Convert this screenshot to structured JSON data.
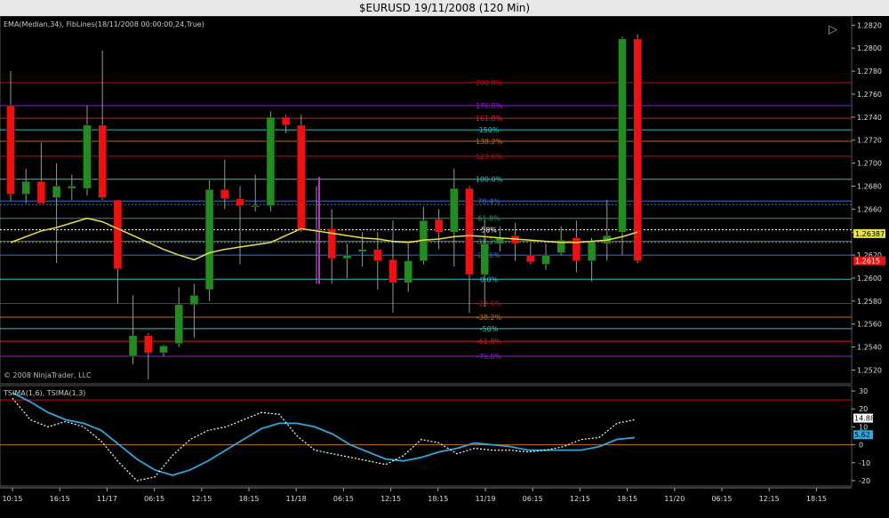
{
  "title": "$EURUSD  19/11/2008 (120 Min)",
  "indicator_label_main": "EMA(Median,34), FibLines(18/11/2008 00:00:00,24,True)",
  "indicator_label_sub": "TSIMA(1,6), TSIMA(1,3)",
  "copyright": "© 2008 NinjaTrader, LLC",
  "colors": {
    "up": "#228b22",
    "down": "#e11",
    "ema": "#e6e04a",
    "tsima6": "#2ea7e0",
    "tsima3": "#ffffff"
  },
  "chart_data": [
    {
      "type": "candlestick",
      "ylim": [
        1.2508,
        1.2828
      ],
      "price_ticks": [
        "1.2520",
        "1.2540",
        "1.2560",
        "1.2580",
        "1.2600",
        "1.2620",
        "1.2640",
        "1.2660",
        "1.2680",
        "1.2700",
        "1.2720",
        "1.2740",
        "1.2760",
        "1.2780",
        "1.2800",
        "1.2820"
      ],
      "x_ticks": [
        "10:15",
        "16:15",
        "11/17",
        "06:15",
        "12:15",
        "18:15",
        "11/18",
        "06:15",
        "12:15",
        "18:15",
        "11/19",
        "06:15",
        "12:15",
        "18:15",
        "11/20",
        "06:15",
        "12:15",
        "18:15"
      ],
      "candles": [
        {
          "o": 1.275,
          "h": 1.278,
          "l": 1.2667,
          "c": 1.2673
        },
        {
          "o": 1.2673,
          "h": 1.2695,
          "l": 1.2665,
          "c": 1.2684
        },
        {
          "o": 1.2684,
          "h": 1.2718,
          "l": 1.2665,
          "c": 1.2665
        },
        {
          "o": 1.267,
          "h": 1.27,
          "l": 1.2613,
          "c": 1.268
        },
        {
          "o": 1.2678,
          "h": 1.269,
          "l": 1.2668,
          "c": 1.268
        },
        {
          "o": 1.2678,
          "h": 1.275,
          "l": 1.2672,
          "c": 1.2733
        },
        {
          "o": 1.2733,
          "h": 1.2798,
          "l": 1.2668,
          "c": 1.267
        },
        {
          "o": 1.2668,
          "h": 1.2668,
          "l": 1.2578,
          "c": 1.2608
        },
        {
          "o": 1.2532,
          "h": 1.2585,
          "l": 1.2525,
          "c": 1.255
        },
        {
          "o": 1.255,
          "h": 1.2552,
          "l": 1.2512,
          "c": 1.2535
        },
        {
          "o": 1.2535,
          "h": 1.2542,
          "l": 1.2532,
          "c": 1.2541
        },
        {
          "o": 1.2543,
          "h": 1.2592,
          "l": 1.254,
          "c": 1.2577
        },
        {
          "o": 1.2577,
          "h": 1.2595,
          "l": 1.2548,
          "c": 1.2585
        },
        {
          "o": 1.259,
          "h": 1.2685,
          "l": 1.258,
          "c": 1.2677
        },
        {
          "o": 1.2677,
          "h": 1.2703,
          "l": 1.266,
          "c": 1.2669
        },
        {
          "o": 1.2669,
          "h": 1.268,
          "l": 1.2612,
          "c": 1.2663
        },
        {
          "o": 1.2663,
          "h": 1.269,
          "l": 1.2658,
          "c": 1.2663
        },
        {
          "o": 1.2663,
          "h": 1.2745,
          "l": 1.2658,
          "c": 1.274
        },
        {
          "o": 1.274,
          "h": 1.2742,
          "l": 1.2726,
          "c": 1.2733
        },
        {
          "o": 1.2733,
          "h": 1.2742,
          "l": 1.264,
          "c": 1.2642
        },
        {
          "o": 1.2642,
          "h": 1.268,
          "l": 1.2595,
          "c": 1.2642
        },
        {
          "o": 1.2643,
          "h": 1.266,
          "l": 1.2595,
          "c": 1.2617
        },
        {
          "o": 1.2617,
          "h": 1.263,
          "l": 1.26,
          "c": 1.262
        },
        {
          "o": 1.2623,
          "h": 1.264,
          "l": 1.261,
          "c": 1.2625
        },
        {
          "o": 1.2625,
          "h": 1.264,
          "l": 1.259,
          "c": 1.2615
        },
        {
          "o": 1.2616,
          "h": 1.265,
          "l": 1.257,
          "c": 1.2596
        },
        {
          "o": 1.2596,
          "h": 1.263,
          "l": 1.2588,
          "c": 1.2615
        },
        {
          "o": 1.2615,
          "h": 1.2662,
          "l": 1.2612,
          "c": 1.265
        },
        {
          "o": 1.2651,
          "h": 1.266,
          "l": 1.2625,
          "c": 1.264
        },
        {
          "o": 1.264,
          "h": 1.2695,
          "l": 1.261,
          "c": 1.2678
        },
        {
          "o": 1.2678,
          "h": 1.268,
          "l": 1.257,
          "c": 1.2603
        },
        {
          "o": 1.2603,
          "h": 1.265,
          "l": 1.2575,
          "c": 1.263
        },
        {
          "o": 1.263,
          "h": 1.2645,
          "l": 1.2623,
          "c": 1.2635
        },
        {
          "o": 1.2637,
          "h": 1.2648,
          "l": 1.2615,
          "c": 1.263
        },
        {
          "o": 1.262,
          "h": 1.263,
          "l": 1.2612,
          "c": 1.2614
        },
        {
          "o": 1.2612,
          "h": 1.263,
          "l": 1.2607,
          "c": 1.262
        },
        {
          "o": 1.2622,
          "h": 1.2645,
          "l": 1.262,
          "c": 1.2633
        },
        {
          "o": 1.2635,
          "h": 1.265,
          "l": 1.2605,
          "c": 1.2615
        },
        {
          "o": 1.2615,
          "h": 1.2635,
          "l": 1.2597,
          "c": 1.2632
        },
        {
          "o": 1.263,
          "h": 1.2668,
          "l": 1.2615,
          "c": 1.2637
        },
        {
          "o": 1.264,
          "h": 1.281,
          "l": 1.262,
          "c": 1.2808
        },
        {
          "o": 1.2808,
          "h": 1.2812,
          "l": 1.2613,
          "c": 1.2615
        }
      ],
      "ema": [
        1.2631,
        1.2636,
        1.2641,
        1.2644,
        1.2648,
        1.2652,
        1.2649,
        1.2643,
        1.2637,
        1.2631,
        1.2625,
        1.262,
        1.2616,
        1.2622,
        1.2625,
        1.2627,
        1.2629,
        1.2631,
        1.2637,
        1.2643,
        1.2641,
        1.2639,
        1.2637,
        1.2635,
        1.2634,
        1.2632,
        1.2631,
        1.2633,
        1.2634,
        1.2636,
        1.2637,
        1.2636,
        1.2635,
        1.2634,
        1.2633,
        1.2632,
        1.2631,
        1.2631,
        1.2632,
        1.2633,
        1.2636,
        1.264
      ],
      "fib_levels": [
        {
          "label": "200.0%",
          "price": 1.277,
          "color": "#c01010"
        },
        {
          "label": "176.8%",
          "price": 1.275,
          "color": "#8e1fc4"
        },
        {
          "label": "161.8%",
          "price": 1.2739,
          "color": "#d02525"
        },
        {
          "label": "150%",
          "price": 1.2729,
          "color": "#2ec4c4"
        },
        {
          "label": "138.2%",
          "price": 1.2719,
          "color": "#c07020"
        },
        {
          "label": "123.6%",
          "price": 1.2706,
          "color": "#c01010"
        },
        {
          "label": "100.0%",
          "price": 1.2686,
          "color": "#2ec4c4"
        },
        {
          "label": "78.4%",
          "price": 1.2667,
          "color": "#3a6fd0"
        },
        {
          "label": "61.8%",
          "price": 1.2652,
          "color": "#2e9c5c"
        },
        {
          "label": "50%",
          "price": 1.2642,
          "color": "#ffffff"
        },
        {
          "label": "38.2%",
          "price": 1.2632,
          "color": "#2e9c5c"
        },
        {
          "label": "23.6%",
          "price": 1.262,
          "color": "#3a6fd0"
        },
        {
          "label": "0.0%",
          "price": 1.2599,
          "color": "#2ec4c4"
        },
        {
          "label": "-23.6%",
          "price": 1.2578,
          "color": "#c01010"
        },
        {
          "label": "-38.2%",
          "price": 1.2566,
          "color": "#c07020"
        },
        {
          "label": "-50%",
          "price": 1.2556,
          "color": "#2ec4c4"
        },
        {
          "label": "-61.8%",
          "price": 1.2545,
          "color": "#d02525"
        },
        {
          "label": "-76.8%",
          "price": 1.2532,
          "color": "#8e1fc4"
        }
      ],
      "price_markers": [
        {
          "label": "1.26387",
          "price": 1.26387,
          "color": "#e6e04a"
        },
        {
          "label": "1.2615",
          "price": 1.2615,
          "color": "#e11"
        }
      ]
    },
    {
      "type": "line",
      "ylim": [
        -23,
        33
      ],
      "y_ticks": [
        "30",
        "20",
        "10",
        "0",
        "-10",
        "-20"
      ],
      "series": [
        {
          "name": "TSIMA(1,6)",
          "values": [
            29,
            24,
            18,
            14,
            12,
            8,
            0,
            -8,
            -14,
            -17,
            -14,
            -9,
            -3,
            3,
            9,
            12,
            12,
            10,
            6,
            0,
            -4,
            -8,
            -9,
            -7,
            -4,
            -2,
            1,
            0,
            -1,
            -3,
            -3,
            -3,
            -3,
            -1,
            3,
            4
          ]
        },
        {
          "name": "TSIMA(1,3)",
          "values": [
            26,
            14,
            10,
            13,
            10,
            2,
            -10,
            -20,
            -18,
            -6,
            3,
            8,
            10,
            14,
            18,
            17,
            5,
            -3,
            -5,
            -7,
            -9,
            -11,
            -6,
            3,
            1,
            -5,
            -2,
            -3,
            -3,
            -4,
            -3,
            -1,
            3,
            4,
            12,
            14
          ]
        }
      ],
      "value_markers": [
        {
          "label": "14.88",
          "value": 14.88,
          "color": "#ffffff"
        },
        {
          "label": "5.62",
          "value": 5.62,
          "color": "#2ea7e0"
        }
      ]
    }
  ]
}
